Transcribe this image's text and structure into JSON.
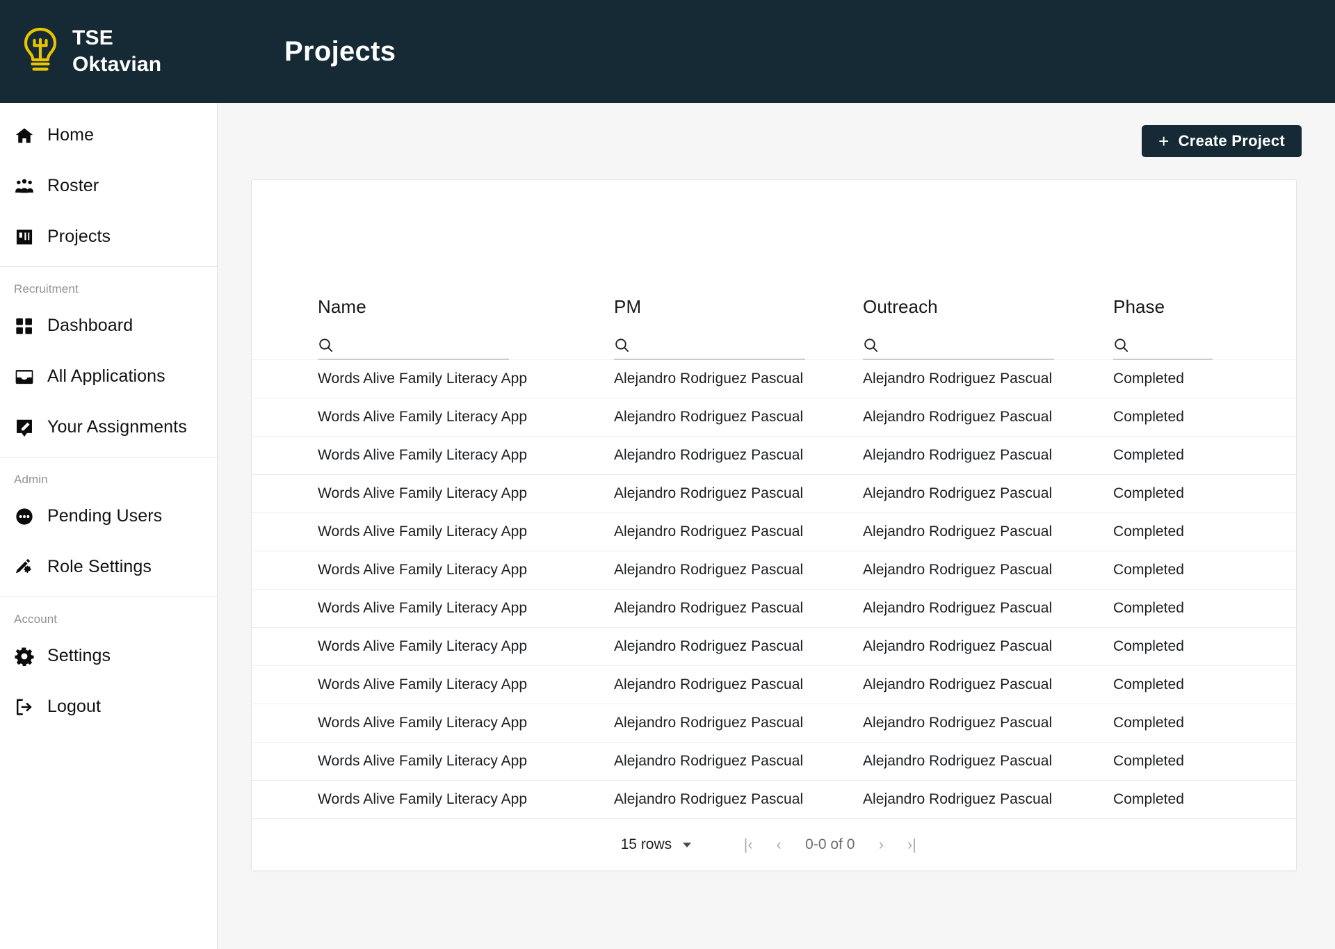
{
  "brand": {
    "name": "TSE\nOktavian",
    "logo_icon": "lightbulb-trident-icon",
    "logo_color": "#e8c500"
  },
  "header": {
    "title": "Projects",
    "background": "#152a35"
  },
  "toolbar": {
    "create_label": "Create Project",
    "plus_glyph": "+"
  },
  "sidebar": {
    "groups": [
      {
        "label": "",
        "items": [
          {
            "label": "Home",
            "icon": "home-icon"
          },
          {
            "label": "Roster",
            "icon": "people-group-icon"
          },
          {
            "label": "Projects",
            "icon": "projects-icon"
          }
        ]
      },
      {
        "label": "Recruitment",
        "items": [
          {
            "label": "Dashboard",
            "icon": "grid-dashboard-icon"
          },
          {
            "label": "All Applications",
            "icon": "inbox-icon"
          },
          {
            "label": "Your Assignments",
            "icon": "tag-pencil-icon"
          }
        ]
      },
      {
        "label": "Admin",
        "items": [
          {
            "label": "Pending Users",
            "icon": "ellipsis-circle-icon"
          },
          {
            "label": "Role Settings",
            "icon": "pencil-gear-icon"
          }
        ]
      },
      {
        "label": "Account",
        "items": [
          {
            "label": "Settings",
            "icon": "gear-icon"
          },
          {
            "label": "Logout",
            "icon": "logout-icon"
          }
        ]
      }
    ]
  },
  "table": {
    "columns": [
      {
        "label": "Name",
        "search_value": "",
        "search_placeholder": "",
        "search_icon": "search-icon"
      },
      {
        "label": "PM",
        "search_value": "",
        "search_placeholder": "",
        "search_icon": "search-icon"
      },
      {
        "label": "Outreach",
        "search_value": "",
        "search_placeholder": "",
        "search_icon": "search-icon"
      },
      {
        "label": "Phase",
        "search_value": "",
        "search_placeholder": "",
        "search_icon": "search-icon"
      }
    ],
    "rows": [
      {
        "name": "Words Alive Family Literacy App",
        "pm": "Alejandro Rodriguez Pascual",
        "outreach": "Alejandro Rodriguez Pascual",
        "phase": "Completed"
      },
      {
        "name": "Words Alive Family Literacy App",
        "pm": "Alejandro Rodriguez Pascual",
        "outreach": "Alejandro Rodriguez Pascual",
        "phase": "Completed"
      },
      {
        "name": "Words Alive Family Literacy App",
        "pm": "Alejandro Rodriguez Pascual",
        "outreach": "Alejandro Rodriguez Pascual",
        "phase": "Completed"
      },
      {
        "name": "Words Alive Family Literacy App",
        "pm": "Alejandro Rodriguez Pascual",
        "outreach": "Alejandro Rodriguez Pascual",
        "phase": "Completed"
      },
      {
        "name": "Words Alive Family Literacy App",
        "pm": "Alejandro Rodriguez Pascual",
        "outreach": "Alejandro Rodriguez Pascual",
        "phase": "Completed"
      },
      {
        "name": "Words Alive Family Literacy App",
        "pm": "Alejandro Rodriguez Pascual",
        "outreach": "Alejandro Rodriguez Pascual",
        "phase": "Completed"
      },
      {
        "name": "Words Alive Family Literacy App",
        "pm": "Alejandro Rodriguez Pascual",
        "outreach": "Alejandro Rodriguez Pascual",
        "phase": "Completed"
      },
      {
        "name": "Words Alive Family Literacy App",
        "pm": "Alejandro Rodriguez Pascual",
        "outreach": "Alejandro Rodriguez Pascual",
        "phase": "Completed"
      },
      {
        "name": "Words Alive Family Literacy App",
        "pm": "Alejandro Rodriguez Pascual",
        "outreach": "Alejandro Rodriguez Pascual",
        "phase": "Completed"
      },
      {
        "name": "Words Alive Family Literacy App",
        "pm": "Alejandro Rodriguez Pascual",
        "outreach": "Alejandro Rodriguez Pascual",
        "phase": "Completed"
      },
      {
        "name": "Words Alive Family Literacy App",
        "pm": "Alejandro Rodriguez Pascual",
        "outreach": "Alejandro Rodriguez Pascual",
        "phase": "Completed"
      },
      {
        "name": "Words Alive Family Literacy App",
        "pm": "Alejandro Rodriguez Pascual",
        "outreach": "Alejandro Rodriguez Pascual",
        "phase": "Completed"
      }
    ]
  },
  "pagination": {
    "rows_per_page": "15 rows",
    "range_text": "0-0 of 0",
    "first_glyph": "|‹",
    "prev_glyph": "‹",
    "next_glyph": "›",
    "last_glyph": "›|"
  }
}
